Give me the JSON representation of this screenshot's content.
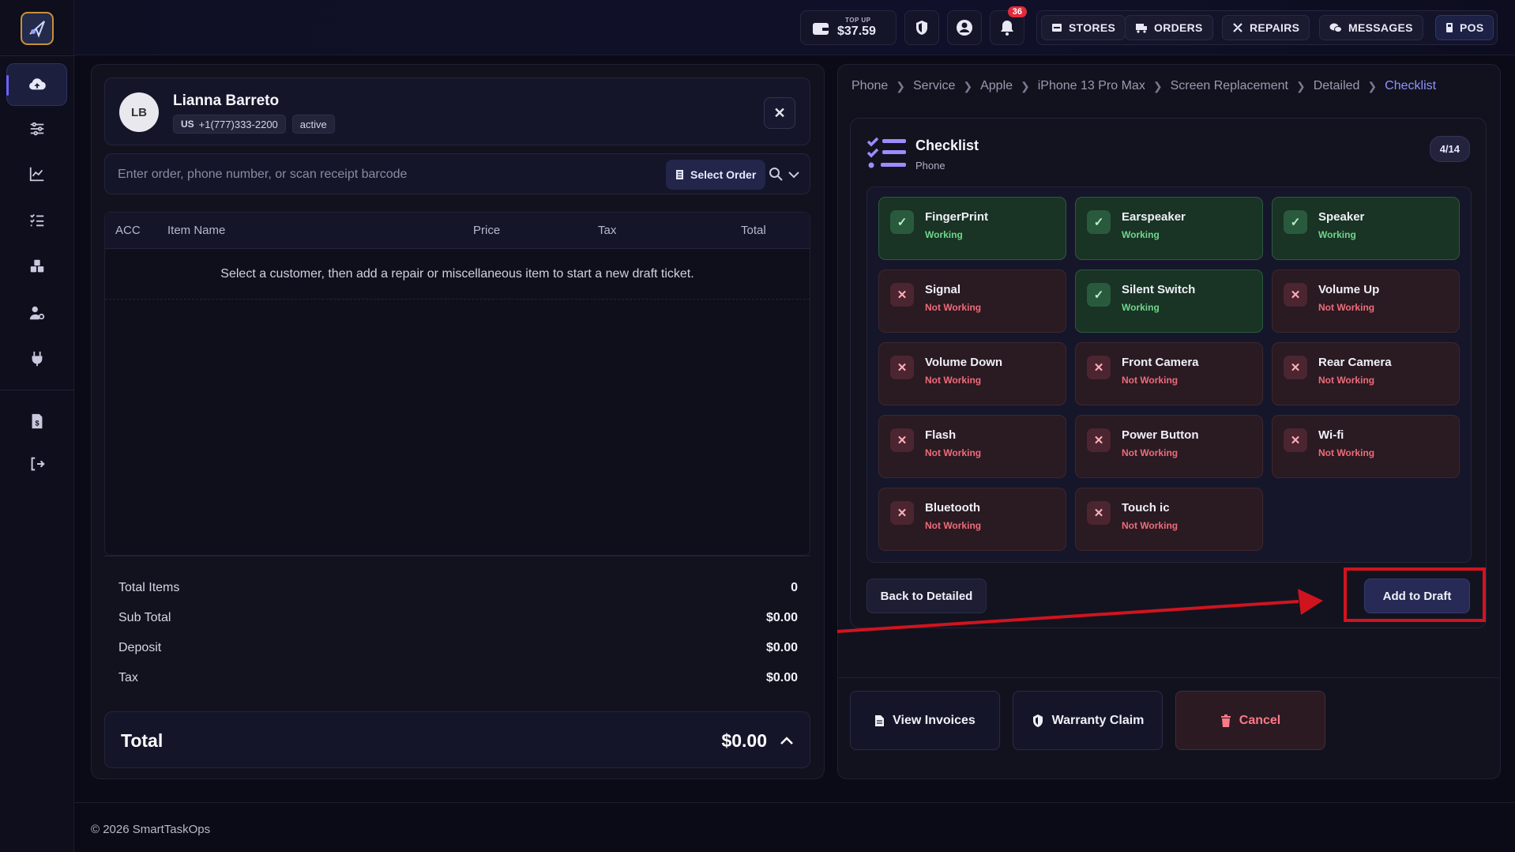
{
  "wallet": {
    "top_up_label": "TOP UP",
    "balance": "$37.59"
  },
  "notifications": {
    "count": "36"
  },
  "nav": [
    {
      "label": "STORES",
      "icon": "store-icon"
    },
    {
      "label": "ORDERS",
      "icon": "truck-icon"
    },
    {
      "label": "REPAIRS",
      "icon": "tools-icon"
    },
    {
      "label": "MESSAGES",
      "icon": "chat-icon"
    },
    {
      "label": "POS",
      "icon": "terminal-icon"
    }
  ],
  "customer": {
    "initials": "LB",
    "name": "Lianna Barreto",
    "country": "US",
    "phone": "+1(777)333-2200",
    "status": "active"
  },
  "search": {
    "placeholder": "Enter order, phone number, or scan receipt barcode",
    "select_order_label": "Select Order"
  },
  "table": {
    "columns": [
      "ACC",
      "Item Name",
      "Price",
      "Tax",
      "Total"
    ],
    "empty_message": "Select a customer, then add a repair or miscellaneous item to start a new draft ticket."
  },
  "summary": {
    "total_items_label": "Total Items",
    "total_items": "0",
    "sub_total_label": "Sub Total",
    "sub_total": "$0.00",
    "deposit_label": "Deposit",
    "deposit": "$0.00",
    "tax_label": "Tax",
    "tax": "$0.00",
    "total_label": "Total",
    "total": "$0.00"
  },
  "breadcrumb": [
    "Phone",
    "Service",
    "Apple",
    "iPhone 13 Pro Max",
    "Screen Replacement",
    "Detailed",
    "Checklist"
  ],
  "checklist": {
    "title": "Checklist",
    "subtitle": "Phone",
    "progress": "4/14",
    "items": [
      {
        "name": "FingerPrint",
        "status": "Working",
        "ok": true
      },
      {
        "name": "Earspeaker",
        "status": "Working",
        "ok": true
      },
      {
        "name": "Speaker",
        "status": "Working",
        "ok": true
      },
      {
        "name": "Signal",
        "status": "Not Working",
        "ok": false
      },
      {
        "name": "Silent Switch",
        "status": "Working",
        "ok": true
      },
      {
        "name": "Volume Up",
        "status": "Not Working",
        "ok": false
      },
      {
        "name": "Volume Down",
        "status": "Not Working",
        "ok": false
      },
      {
        "name": "Front Camera",
        "status": "Not Working",
        "ok": false
      },
      {
        "name": "Rear Camera",
        "status": "Not Working",
        "ok": false
      },
      {
        "name": "Flash",
        "status": "Not Working",
        "ok": false
      },
      {
        "name": "Power Button",
        "status": "Not Working",
        "ok": false
      },
      {
        "name": "Wi-fi",
        "status": "Not Working",
        "ok": false
      },
      {
        "name": "Bluetooth",
        "status": "Not Working",
        "ok": false
      },
      {
        "name": "Touch ic",
        "status": "Not Working",
        "ok": false
      }
    ],
    "back_label": "Back to Detailed",
    "add_label": "Add to Draft"
  },
  "actions": {
    "view_invoices": "View Invoices",
    "warranty_claim": "Warranty Claim",
    "cancel": "Cancel"
  },
  "footer": {
    "copyright": "© 2026 SmartTaskOps"
  },
  "colors": {
    "accent": "#6c63ff",
    "working": "#6fd68c",
    "not_working": "#ef6b7a",
    "annotation": "#d0141f"
  }
}
